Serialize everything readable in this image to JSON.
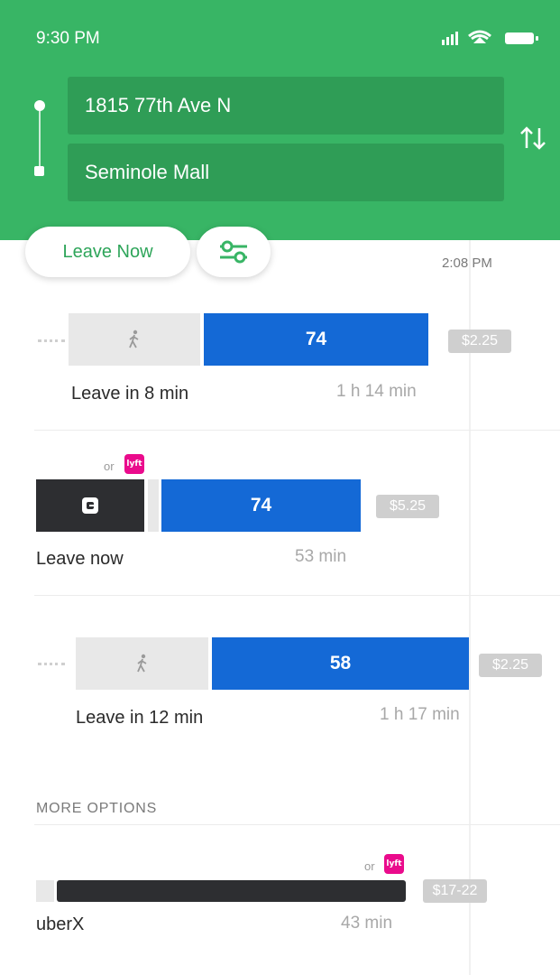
{
  "status_bar": {
    "time": "9:30 PM"
  },
  "search": {
    "origin": "1815 77th Ave N",
    "destination": "Seminole Mall"
  },
  "controls": {
    "leave_now_label": "Leave Now",
    "filter_icon": "sliders-icon",
    "swap_icon": "swap-arrows-icon"
  },
  "arrival_time": "2:08 PM",
  "routes": [
    {
      "mode": "walk+bus",
      "bus_number": "74",
      "price": "$2.25",
      "leave": "Leave in 8 min",
      "duration": "1 h 14 min"
    },
    {
      "mode": "rideshare+bus",
      "or_text": "or",
      "lyft_badge": "lyft",
      "bus_number": "74",
      "price": "$5.25",
      "leave": "Leave now",
      "duration": "53 min"
    },
    {
      "mode": "walk+bus",
      "bus_number": "58",
      "price": "$2.25",
      "leave": "Leave in 12 min",
      "duration": "1 h 17 min"
    }
  ],
  "more_options": {
    "title": "MORE OPTIONS",
    "items": [
      {
        "or_text": "or",
        "lyft_badge": "lyft",
        "price": "$17-22",
        "name": "uberX",
        "duration": "43 min"
      }
    ]
  },
  "colors": {
    "header_green": "#38b565",
    "bus_blue": "#1469d6",
    "uber_dark": "#2d2e31",
    "lyft_pink": "#ea0b8c"
  }
}
